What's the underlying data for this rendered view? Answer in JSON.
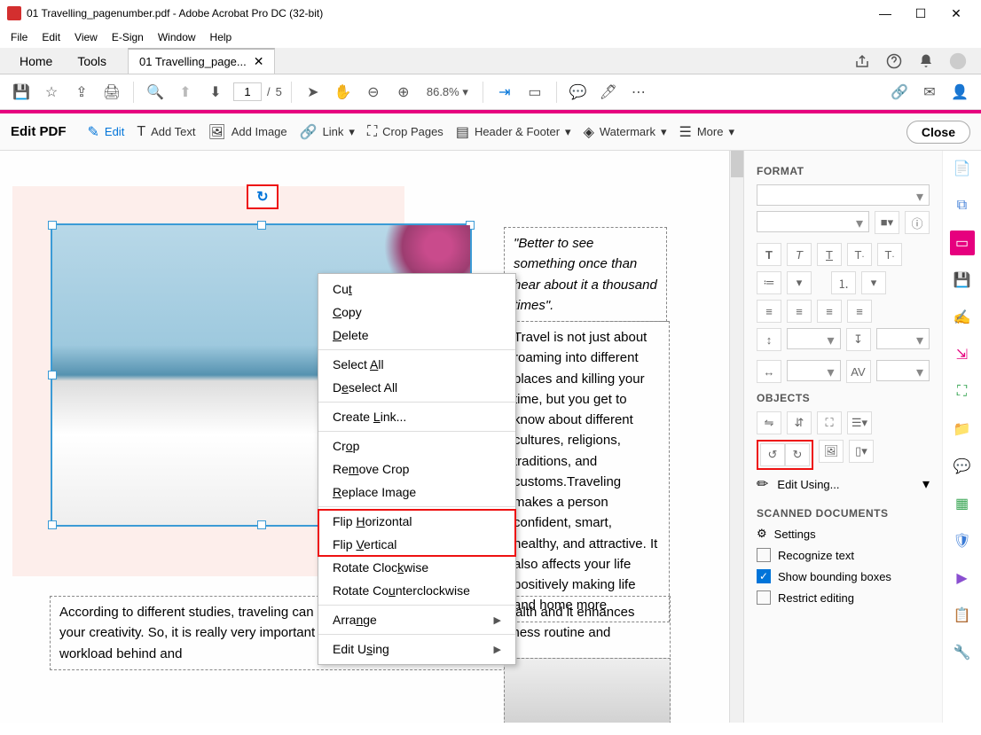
{
  "window": {
    "title": "01 Travelling_pagenumber.pdf - Adobe Acrobat Pro DC (32-bit)"
  },
  "menubar": [
    "File",
    "Edit",
    "View",
    "E-Sign",
    "Window",
    "Help"
  ],
  "tabs": {
    "home": "Home",
    "tools": "Tools",
    "document": "01 Travelling_page..."
  },
  "page": {
    "current": "1",
    "separator": "/",
    "total": "5"
  },
  "zoom": "86.8%",
  "edit_toolbar": {
    "title": "Edit PDF",
    "edit": "Edit",
    "add_text": "Add Text",
    "add_image": "Add Image",
    "link": "Link",
    "crop_pages": "Crop Pages",
    "header_footer": "Header & Footer",
    "watermark": "Watermark",
    "more": "More",
    "close": "Close"
  },
  "document": {
    "quote": "\"Better to see something once than hear about it a thousand times\".",
    "para1": "Travel is not just about roaming into different places and killing your time, but you get to know about different cultures, religions, traditions, and customs.Traveling makes a person confident, smart, healthy, and attractive. It also affects your life positively making life and home more",
    "para2": "According to different studies, traveling can have a positive impact on your health and it enhances your creativity. So, it is really very important to leave your hectic office or business routine and workload behind and"
  },
  "context_menu": {
    "cut": "Cut",
    "copy": "Copy",
    "delete": "Delete",
    "select_all": "Select All",
    "deselect_all": "Deselect All",
    "create_link": "Create Link...",
    "crop": "Crop",
    "remove_crop": "Remove Crop",
    "replace_image": "Replace Image",
    "flip_h": "Flip Horizontal",
    "flip_v": "Flip Vertical",
    "rotate_cw": "Rotate Clockwise",
    "rotate_ccw": "Rotate Counterclockwise",
    "arrange": "Arrange",
    "edit_using": "Edit Using"
  },
  "format_panel": {
    "format_heading": "FORMAT",
    "objects_heading": "OBJECTS",
    "edit_using": "Edit Using...",
    "scanned_heading": "SCANNED DOCUMENTS",
    "settings": "Settings",
    "recognize_text": "Recognize text",
    "show_bounding": "Show bounding boxes",
    "restrict_editing": "Restrict editing"
  }
}
